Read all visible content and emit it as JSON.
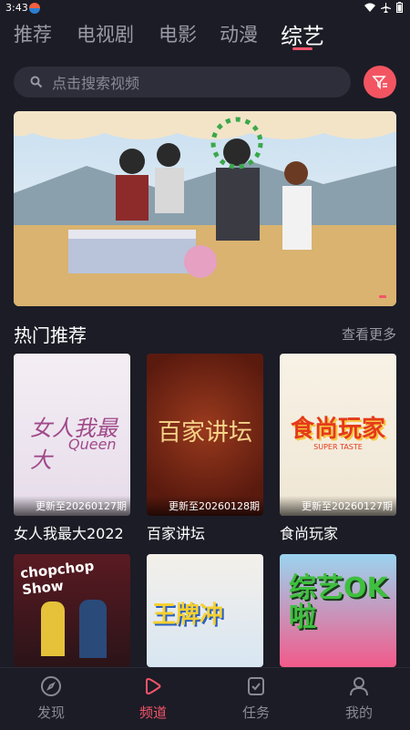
{
  "status": {
    "time": "3:43"
  },
  "tabs": [
    "推荐",
    "电视剧",
    "电影",
    "动漫",
    "综艺"
  ],
  "active_tab": "综艺",
  "search": {
    "placeholder": "点击搜索视频"
  },
  "section": {
    "title": "热门推荐",
    "more": "查看更多"
  },
  "cards": [
    {
      "name": "女人我最大2022",
      "update": "更新至20260127期",
      "poster_text": "女人我最大",
      "poster_sub": "Queen"
    },
    {
      "name": "百家讲坛",
      "update": "更新至20260128期",
      "poster_text": "百家讲坛"
    },
    {
      "name": "食尚玩家",
      "update": "更新至20260127期",
      "poster_text": "食尚玩家",
      "poster_sub": "SUPER TASTE"
    }
  ],
  "row2": [
    {
      "poster_text": "chopchop Show"
    },
    {
      "poster_text": "王牌冲"
    },
    {
      "poster_text": "综艺OK啦"
    }
  ],
  "nav": [
    {
      "label": "发现",
      "icon": "compass-icon"
    },
    {
      "label": "频道",
      "icon": "play-icon"
    },
    {
      "label": "任务",
      "icon": "task-check-icon"
    },
    {
      "label": "我的",
      "icon": "user-icon"
    }
  ],
  "colors": {
    "accent": "#f4546a",
    "background": "#1c1c26",
    "search_bg": "#2e2e3a"
  }
}
